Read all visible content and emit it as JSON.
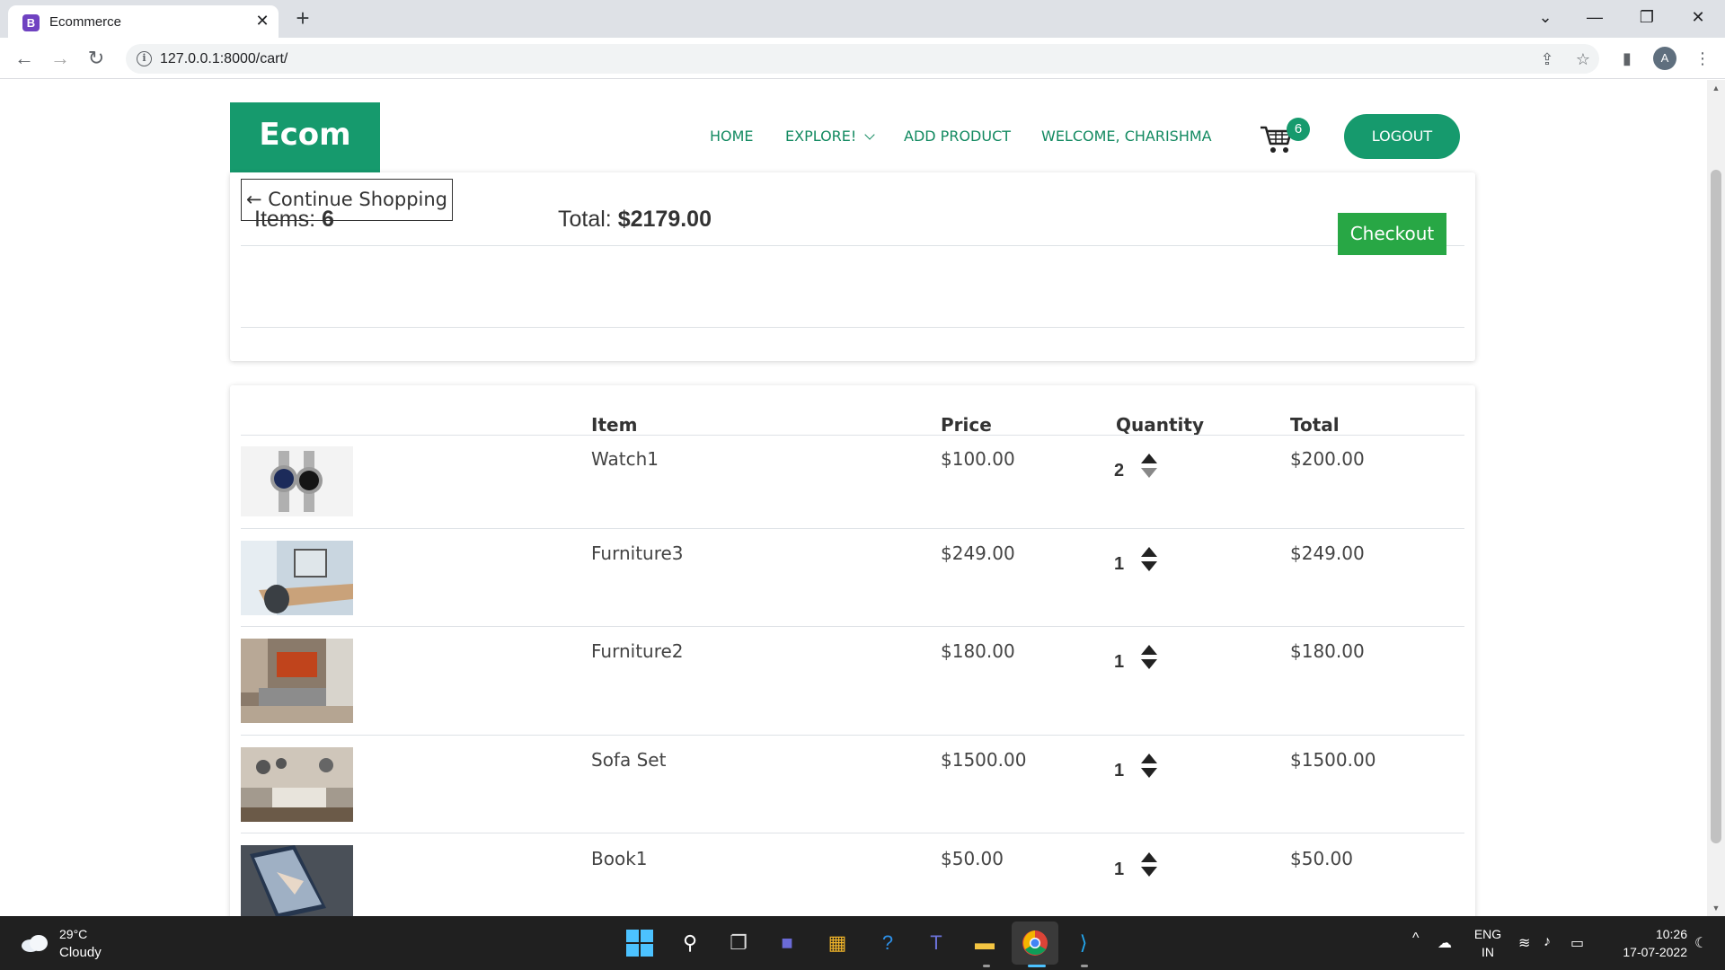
{
  "browser": {
    "tab_title": "Ecommerce",
    "tab_favicon": "B",
    "url": "127.0.0.1:8000/cart/",
    "profile_initial": "A"
  },
  "navbar": {
    "brand": "Ecom",
    "links": [
      "HOME",
      "EXPLORE!",
      "ADD PRODUCT",
      "WELCOME, CHARISHMA"
    ],
    "cart_count": "6",
    "logout": "LOGOUT"
  },
  "summary": {
    "continue_label": "← Continue Shopping",
    "items_label": "Items:",
    "items_value": "6",
    "total_label": "Total:",
    "total_value": "$2179.00",
    "checkout_label": "Checkout"
  },
  "table": {
    "headers": [
      "Item",
      "Price",
      "Quantity",
      "Total"
    ],
    "rows": [
      {
        "item": "Watch1",
        "price": "$100.00",
        "quantity": "2",
        "total": "$200.00"
      },
      {
        "item": "Furniture3",
        "price": "$249.00",
        "quantity": "1",
        "total": "$249.00"
      },
      {
        "item": "Furniture2",
        "price": "$180.00",
        "quantity": "1",
        "total": "$180.00"
      },
      {
        "item": "Sofa Set",
        "price": "$1500.00",
        "quantity": "1",
        "total": "$1500.00"
      },
      {
        "item": "Book1",
        "price": "$50.00",
        "quantity": "1",
        "total": "$50.00"
      }
    ]
  },
  "taskbar": {
    "weather_temp": "29°C",
    "weather_desc": "Cloudy",
    "lang_top": "ENG",
    "lang_bottom": "IN",
    "time": "10:26",
    "date": "17-07-2022"
  },
  "colors": {
    "brand_green": "#169a6d",
    "checkout_green": "#28a745"
  }
}
